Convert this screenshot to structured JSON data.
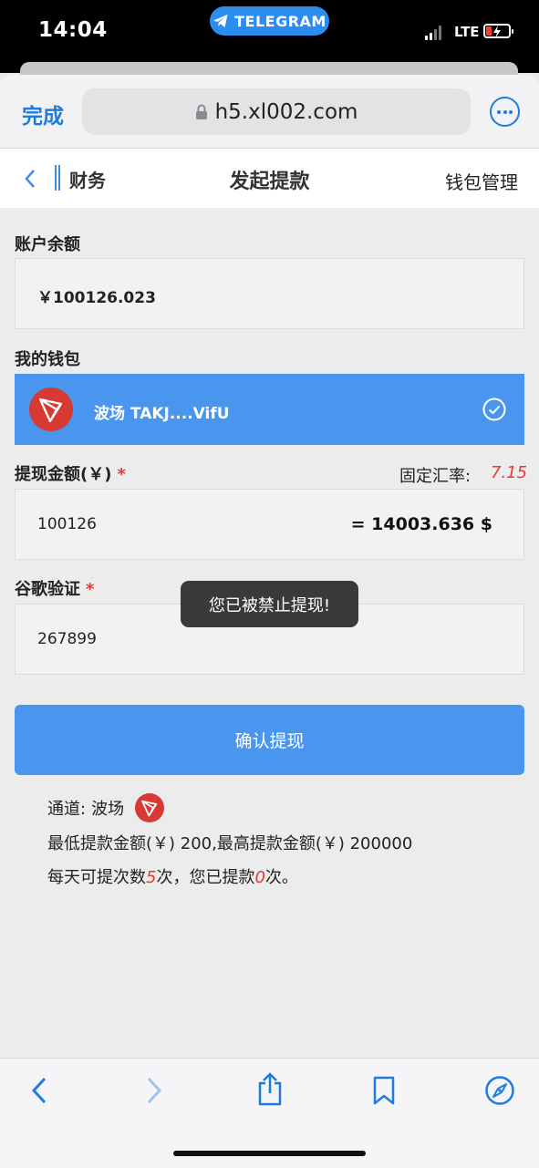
{
  "status_bar": {
    "time": "14:04",
    "app_pill": "TELEGRAM",
    "network": "LTE"
  },
  "browser": {
    "done_label": "完成",
    "url": "h5.xl002.com"
  },
  "nav": {
    "back_label": "财务",
    "title": "发起提款",
    "right_label": "钱包管理"
  },
  "form": {
    "balance_label": "账户余额",
    "balance_value": "￥100126.023",
    "wallet_label": "我的钱包",
    "wallet_name": "波场 TAKJ....VifU",
    "amount_label": "提现金额(￥)",
    "required_mark": "*",
    "rate_label": "固定汇率:",
    "rate_value": "7.15",
    "amount_value": "100126",
    "converted_value": "= 14003.636 $",
    "google_label": "谷歌验证",
    "google_value": "267899",
    "confirm_label": "确认提现"
  },
  "toast": "您已被禁止提现!",
  "info": {
    "channel_label": "通道:",
    "channel_name": "波场",
    "limits": "最低提款金额(￥) 200,最高提款金额(￥) 200000",
    "daily_prefix": "每天可提次数",
    "daily_count": "5",
    "daily_middle": "次，您已提款",
    "used_count": "0",
    "daily_suffix": "次。"
  },
  "colors": {
    "accent": "#4a96ee",
    "tron_red": "#d63a32",
    "warning_red": "#e53935"
  },
  "icons": [
    "telegram-icon",
    "lock-icon",
    "more-icon",
    "back-chevron-icon",
    "tron-icon",
    "check-circle-icon",
    "browser-back-icon",
    "browser-forward-icon",
    "share-icon",
    "bookmarks-icon",
    "compass-icon"
  ]
}
